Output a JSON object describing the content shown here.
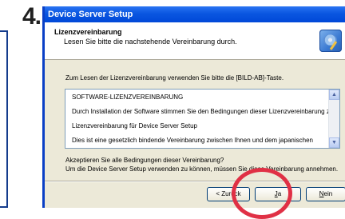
{
  "step_number": "4.",
  "window": {
    "title": "Device Server Setup"
  },
  "header": {
    "title": "Lizenzvereinbarung",
    "subtitle": "Lesen Sie bitte die nachstehende Vereinbarung durch."
  },
  "instruction": "Zum Lesen der Lizenzvereinbarung verwenden Sie bitte die [BILD-AB]-Taste.",
  "license_lines": [
    "SOFTWARE-LIZENZVEREINBARUNG",
    "Durch Installation der Software stimmen Sie den Bedingungen dieser Lizenzvereinbarung zu.",
    "Lizenzvereinbarung für Device Server Setup",
    "Dies ist eine gesetzlich bindende Vereinbarung zwischen Ihnen und dem japanischen"
  ],
  "question": "Akzeptieren Sie alle Bedingungen dieser Vereinbarung?",
  "question_detail": "Um die Device Server Setup verwenden zu können, müssen Sie diese Vereinbarung annehmen.",
  "buttons": {
    "back": "< Zurück",
    "back_mnemonic": "Z",
    "back_rest": "urück",
    "yes_mnemonic": "J",
    "yes_rest": "a",
    "no_mnemonic": "N",
    "no_rest": "ein"
  },
  "colors": {
    "titlebar": "#0a56e0",
    "highlight": "#e03045"
  }
}
